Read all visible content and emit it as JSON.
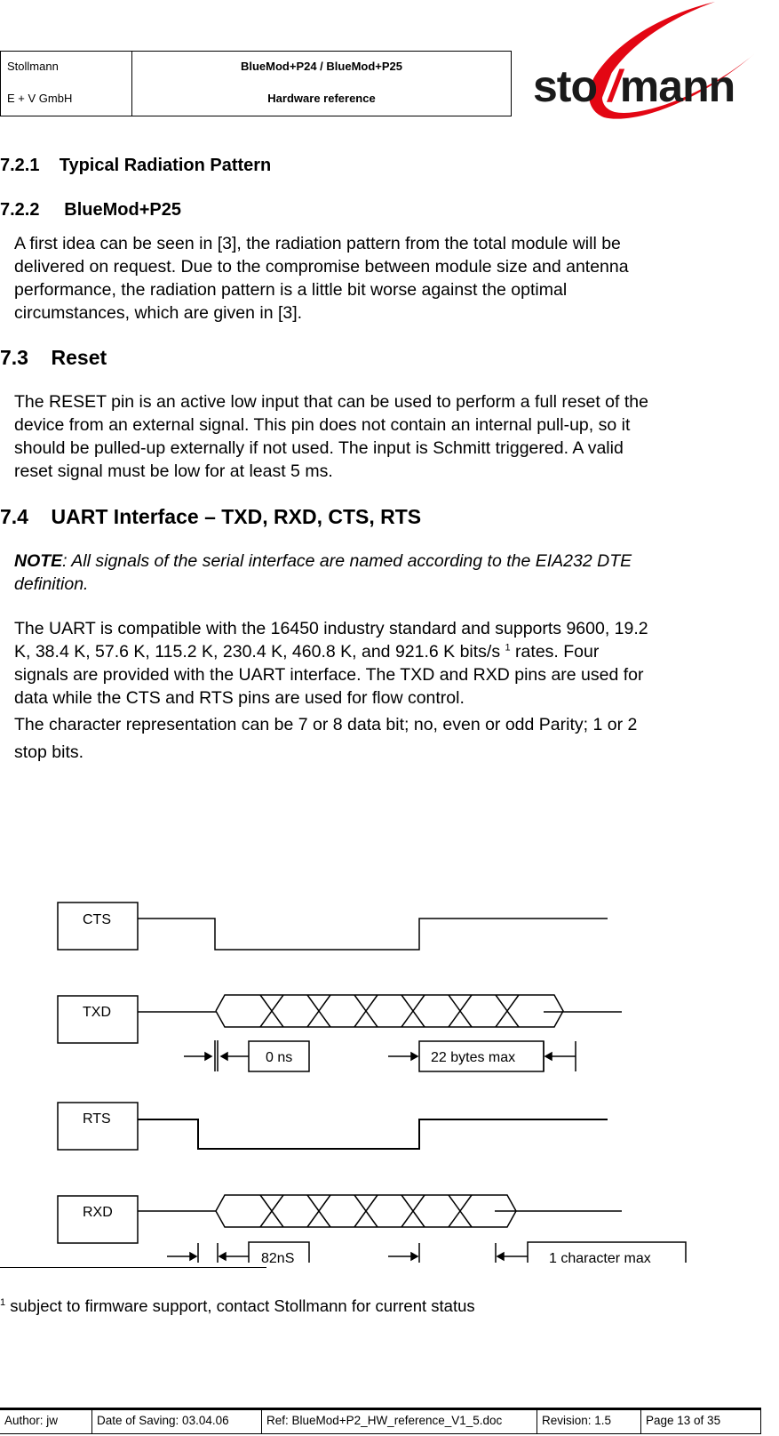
{
  "header": {
    "company_line1": "Stollmann",
    "company_line2": "E + V GmbH",
    "product": "BlueMod+P24 / BlueMod+P25",
    "doc_type": "Hardware reference",
    "logo": {
      "text_left": "sto",
      "text_mid": "//",
      "text_right": "mann",
      "brand_color": "#e30613",
      "text_color": "#1a1a1a"
    }
  },
  "sections": {
    "s721_title": "7.2.1    Typical Radiation Pattern",
    "s722_title": "7.2.2     BlueMod+P25",
    "s722_lines": [
      "A first idea can be seen in [3], the radiation pattern from the total module will be",
      "delivered on request. Due to the compromise between module size and antenna",
      "performance, the radiation pattern is a little bit worse against the optimal",
      "circumstances, which are given in [3]."
    ],
    "s73_title": "7.3    Reset",
    "s73_lines": [
      "The RESET pin is an active low input that can be used to perform a full reset of the",
      "device from an external signal. This pin does not contain an internal pull-up, so it",
      "should be pulled-up externally if not used. The input is Schmitt triggered. A valid",
      "reset signal must be low for at least 5 ms."
    ],
    "s74_title": "7.4    UART Interface – TXD, RXD, CTS, RTS",
    "note_label": "NOTE",
    "note_text_line1": ": All signals of the serial interface are named according to the EIA232 DTE",
    "note_text_line2": "definition.",
    "uart_line1": "The UART is compatible with the 16450 industry standard and supports 9600, 19.2",
    "uart_line2_pre": "K, 38.4 K, 57.6 K, 115.2 K, 230.4 K, 460.8 K, and 921.6 K bits/s ",
    "uart_line2_sup": "1",
    "uart_line2_post": " rates. Four",
    "uart_line3": "signals are provided with the UART interface. The TXD and RXD pins are used for",
    "uart_line4": "data while the CTS and RTS pins are used for flow control.",
    "char_line1": "The character representation can be 7 or 8  data bit;  no, even or odd Parity; 1 or 2",
    "char_line2": "stop bits."
  },
  "timing_diagram": {
    "signals": [
      "CTS",
      "TXD",
      "RTS",
      "RXD"
    ],
    "txd_label_delay": "0 ns",
    "txd_label_max": "22 bytes max",
    "rxd_label_delay": "82nS",
    "rxd_label_max": "1 character max",
    "txd_data_cells": 7,
    "rxd_data_cells": 6
  },
  "footnote": {
    "marker": "1",
    "text": " subject to firmware support, contact Stollmann for current status"
  },
  "footer": {
    "author": "Author: jw",
    "date": "Date of Saving: 03.04.06",
    "ref": "Ref: BlueMod+P2_HW_reference_V1_5.doc",
    "revision": "Revision: 1.5",
    "page": "Page 13 of 35"
  }
}
